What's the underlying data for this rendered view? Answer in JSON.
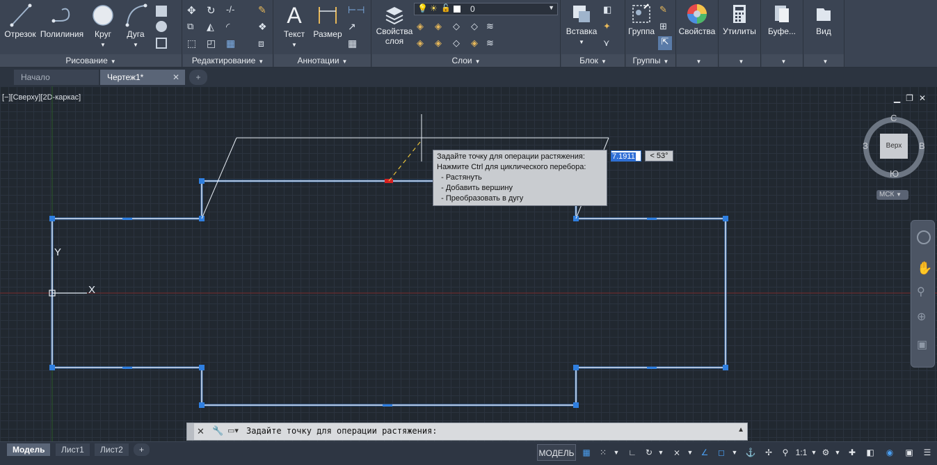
{
  "ribbon": {
    "panels": [
      {
        "title": "Рисование",
        "buttons": [
          "Отрезок",
          "Полилиния",
          "Круг",
          "Дуга"
        ]
      },
      {
        "title": "Редактирование"
      },
      {
        "title": "Аннотации",
        "buttons": [
          "Текст",
          "Размер"
        ]
      },
      {
        "title": "Слои",
        "buttons": [
          "Свойства",
          "слоя"
        ],
        "layer_value": "0"
      },
      {
        "title": "Блок",
        "buttons": [
          "Вставка"
        ]
      },
      {
        "title": "Группы",
        "buttons": [
          "Группа"
        ]
      },
      {
        "title": "",
        "buttons": [
          "Свойства"
        ]
      },
      {
        "title": "",
        "buttons": [
          "Утилиты"
        ]
      },
      {
        "title": "",
        "buttons": [
          "Буфе..."
        ]
      },
      {
        "title": "",
        "buttons": [
          "Вид"
        ]
      }
    ]
  },
  "tabs": [
    {
      "label": "Начало"
    },
    {
      "label": "Чертеж1*"
    }
  ],
  "viewport": {
    "label": "[−][Сверху][2D-каркас]",
    "viewcube": {
      "north": "С",
      "south": "Ю",
      "west": "З",
      "east": "В",
      "face": "Верх",
      "ucs": "МСК"
    },
    "axis_x": "X",
    "axis_y": "Y"
  },
  "tooltip": {
    "lines": [
      "Задайте точку для операции растяжения:",
      "Нажмите Ctrl для циклического перебора:",
      "  - Растянуть",
      "  - Добавить вершину",
      "  - Преобразовать в дугу"
    ]
  },
  "dynamic_input": {
    "length": "7.1911",
    "angle": "< 53°"
  },
  "command_line": {
    "prompt": "Задайте точку для операции растяжения:"
  },
  "status": {
    "layout_tabs": [
      "Модель",
      "Лист1",
      "Лист2"
    ],
    "mode": "МОДЕЛЬ",
    "scale": "1:1"
  }
}
